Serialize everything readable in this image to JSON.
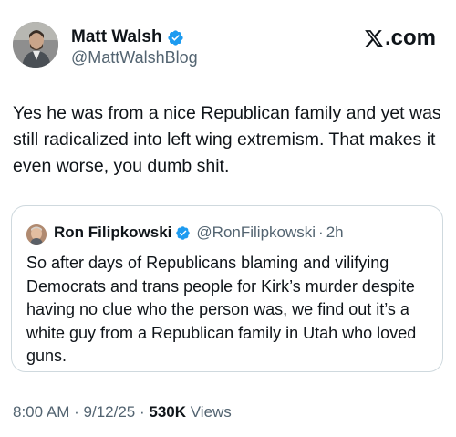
{
  "post": {
    "author_name": "Matt Walsh",
    "author_handle": "@MattWalshBlog",
    "brand": "X.com",
    "brand_suffix": ".com",
    "text": "Yes he was from a nice Republican family and yet was still radicalized into left wing extremism. That makes it even worse, you dumb shit.",
    "time": "8:00 AM",
    "date": "9/12/25",
    "views_count": "530K",
    "views_label": "Views",
    "separator": "·"
  },
  "quote": {
    "author_name": "Ron Filipkowski",
    "author_handle": "@RonFilipkowski",
    "separator": "·",
    "time": "2h",
    "text": "So after days of Republicans blaming and vilifying Democrats and trans people for Kirk’s murder despite having no clue who the person was, we find out it’s a white guy from a Republican family in Utah who loved guns."
  },
  "colors": {
    "verified": "#1d9bf0",
    "secondary_text": "#536471",
    "border": "#cfd9de"
  },
  "icons": {
    "verified": "verified-badge-icon",
    "brand": "x-logo-icon"
  }
}
